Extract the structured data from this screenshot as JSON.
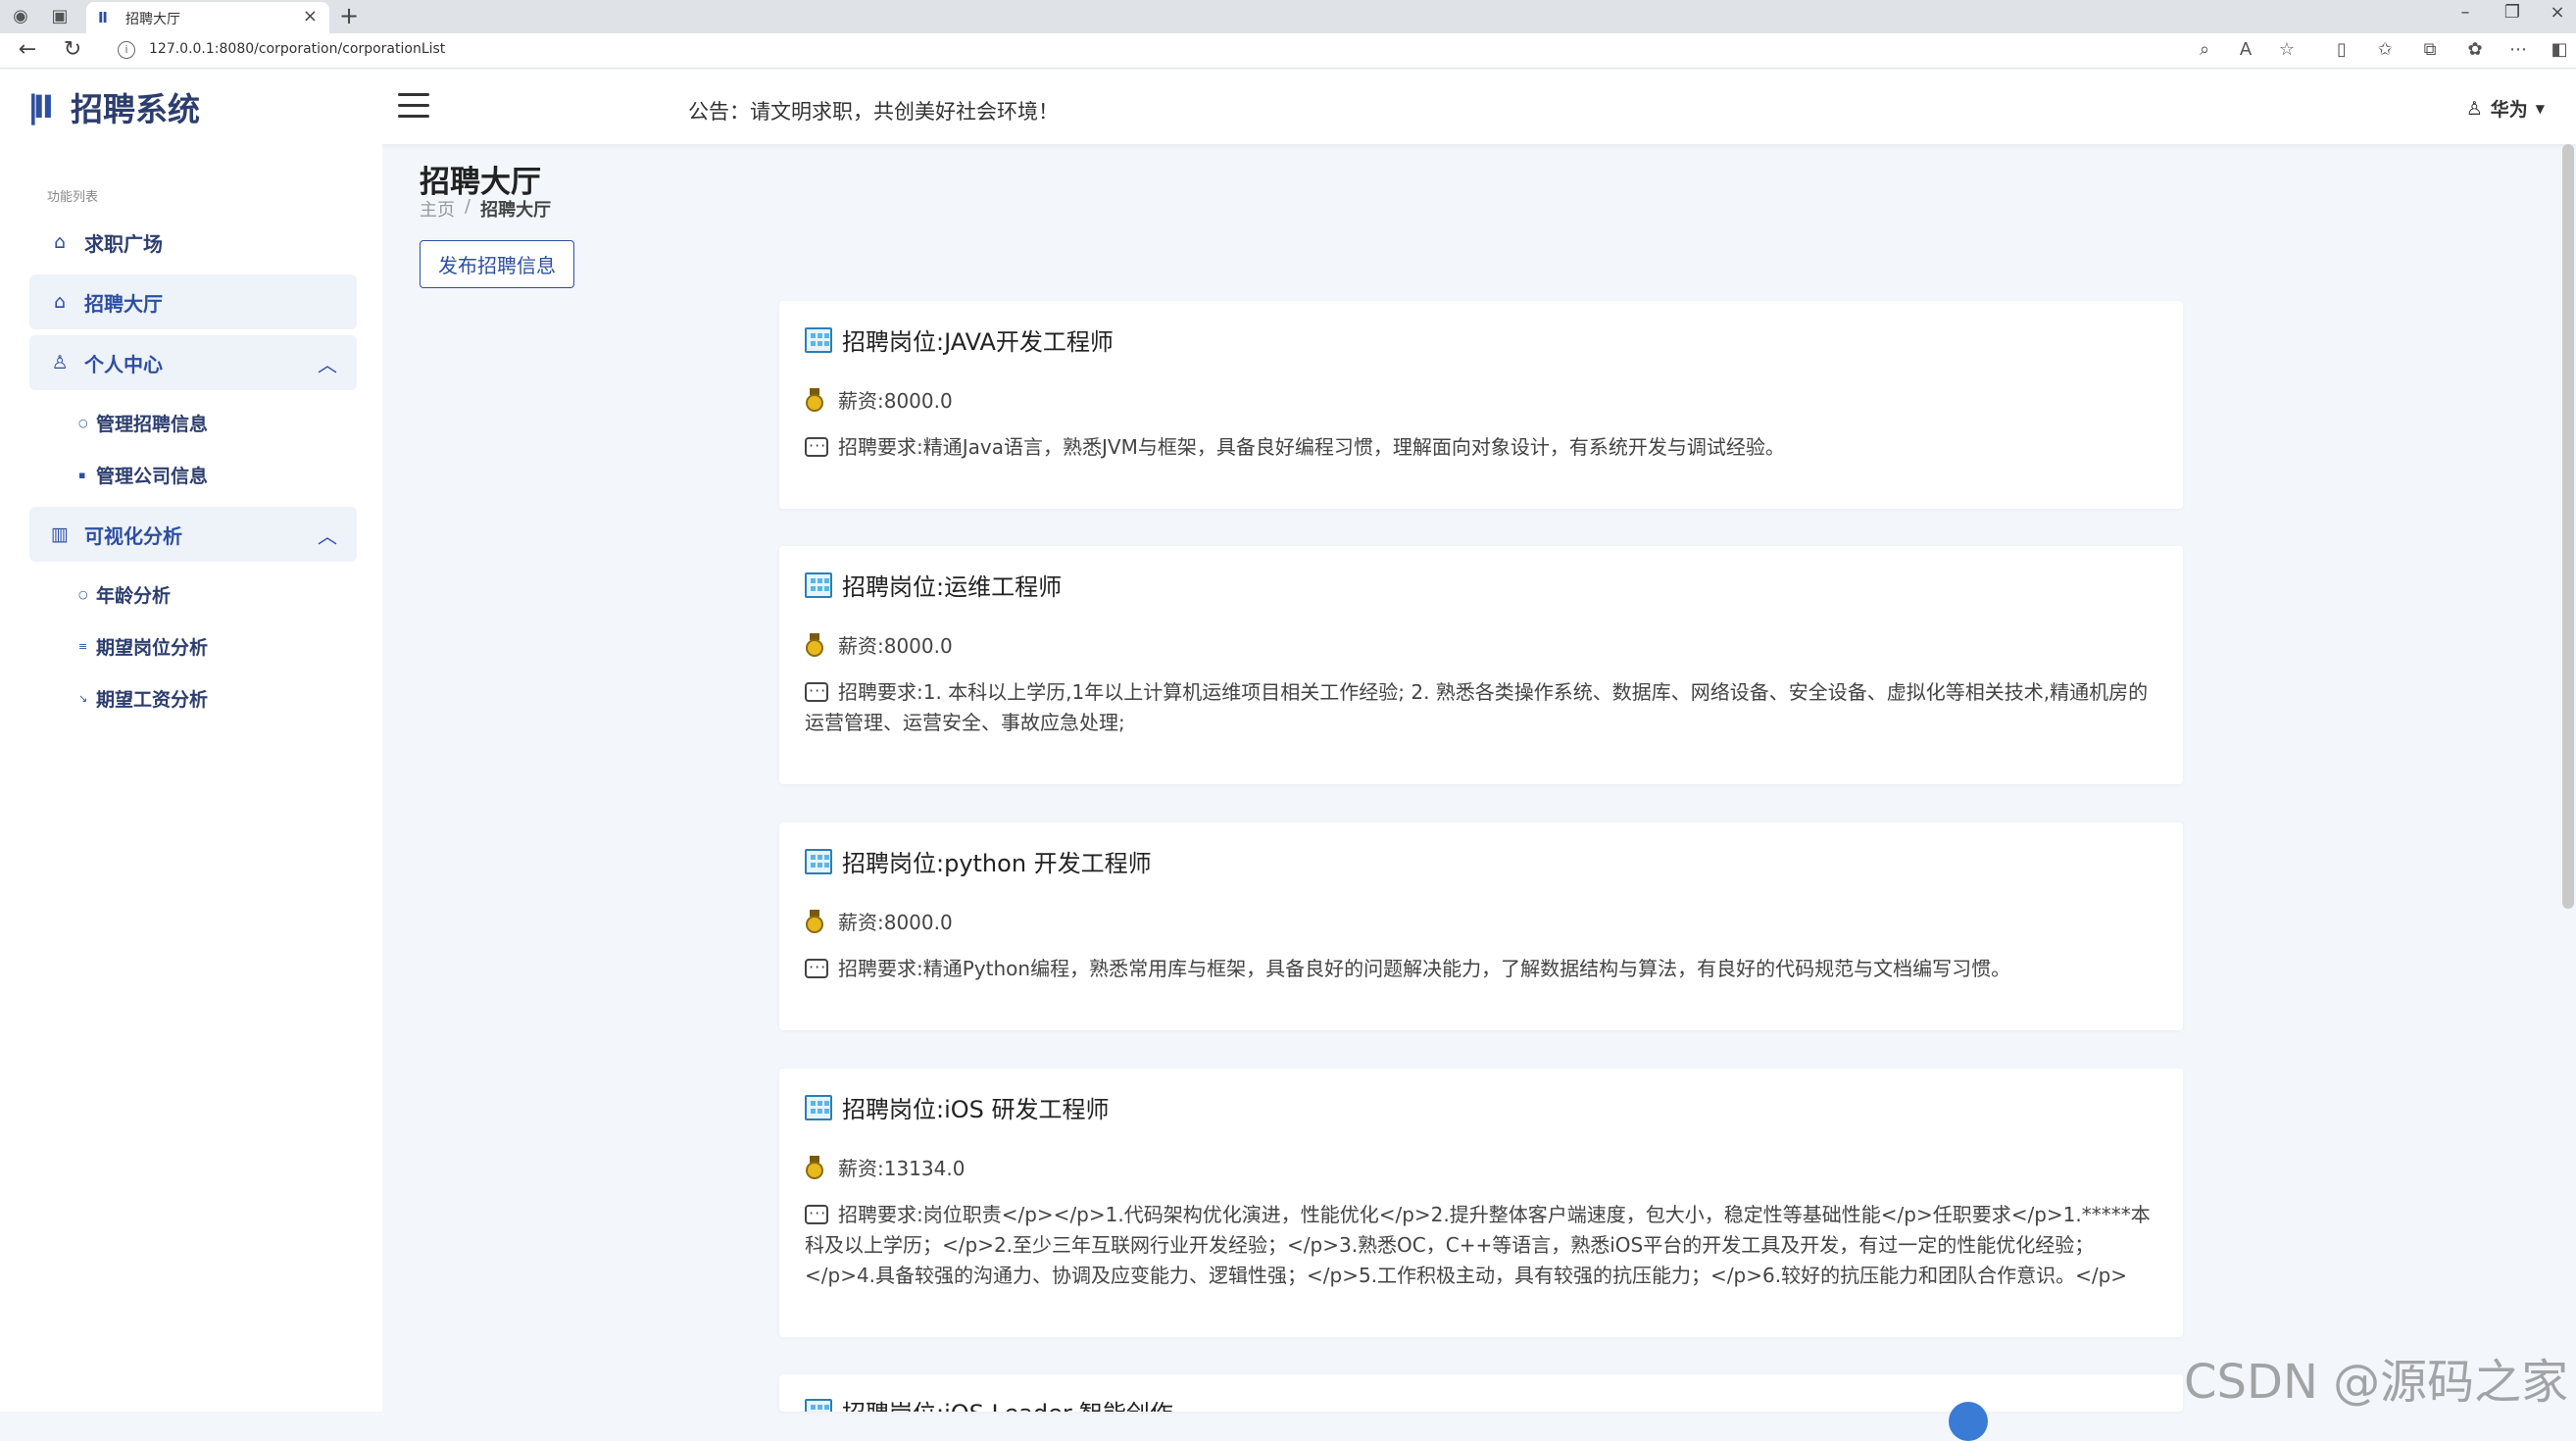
{
  "browser": {
    "tab_title": "招聘大厅",
    "url": "127.0.0.1:8080/corporation/corporationList"
  },
  "header": {
    "logo_text": "招聘系统",
    "notice": "公告：请文明求职，共创美好社会环境！",
    "user": "华为"
  },
  "sidebar": {
    "caption": "功能列表",
    "items": [
      {
        "label": "求职广场",
        "icon": "home-icon"
      },
      {
        "label": "招聘大厅",
        "icon": "home-icon",
        "active": true
      },
      {
        "label": "个人中心",
        "icon": "user-icon",
        "expanded": true,
        "children": [
          {
            "label": "管理招聘信息"
          },
          {
            "label": "管理公司信息"
          }
        ]
      },
      {
        "label": "可视化分析",
        "icon": "bar-chart-icon",
        "expanded": true,
        "children": [
          {
            "label": "年龄分析"
          },
          {
            "label": "期望岗位分析"
          },
          {
            "label": "期望工资分析"
          }
        ]
      }
    ]
  },
  "main": {
    "title": "招聘大厅",
    "breadcrumb": [
      "主页",
      "招聘大厅"
    ],
    "publish_button": "发布招聘信息",
    "jobs": [
      {
        "title": "招聘岗位:JAVA开发工程师",
        "salary": "薪资:8000.0",
        "requirement": "招聘要求:精通Java语言，熟悉JVM与框架，具备良好编程习惯，理解面向对象设计，有系统开发与调试经验。"
      },
      {
        "title": "招聘岗位:运维工程师",
        "salary": "薪资:8000.0",
        "requirement": "招聘要求:1. 本科以上学历,1年以上计算机运维项目相关工作经验; 2. 熟悉各类操作系统、数据库、网络设备、安全设备、虚拟化等相关技术,精通机房的运营管理、运营安全、事故应急处理;"
      },
      {
        "title": "招聘岗位:python 开发工程师",
        "salary": "薪资:8000.0",
        "requirement": "招聘要求:精通Python编程，熟悉常用库与框架，具备良好的问题解决能力，了解数据结构与算法，有良好的代码规范与文档编写习惯。"
      },
      {
        "title": "招聘岗位:iOS 研发工程师",
        "salary": "薪资:13134.0",
        "requirement": "招聘要求:岗位职责</p></p>1.代码架构优化演进，性能优化</p>2.提升整体客户端速度，包大小，稳定性等基础性能</p>任职要求</p>1.*****本科及以上学历；</p>2.至少三年互联网行业开发经验；</p>3.熟悉OC，C++等语言，熟悉iOS平台的开发工具及开发，有过一定的性能优化经验；</p>4.具备较强的沟通力、协调及应变能力、逻辑性强；</p>5.工作积极主动，具有较强的抗压能力；</p>6.较好的抗压能力和团队合作意识。</p>"
      },
      {
        "title": "招聘岗位:iOS Leader-智能创作"
      }
    ]
  },
  "watermark": "CSDN @源码之家"
}
